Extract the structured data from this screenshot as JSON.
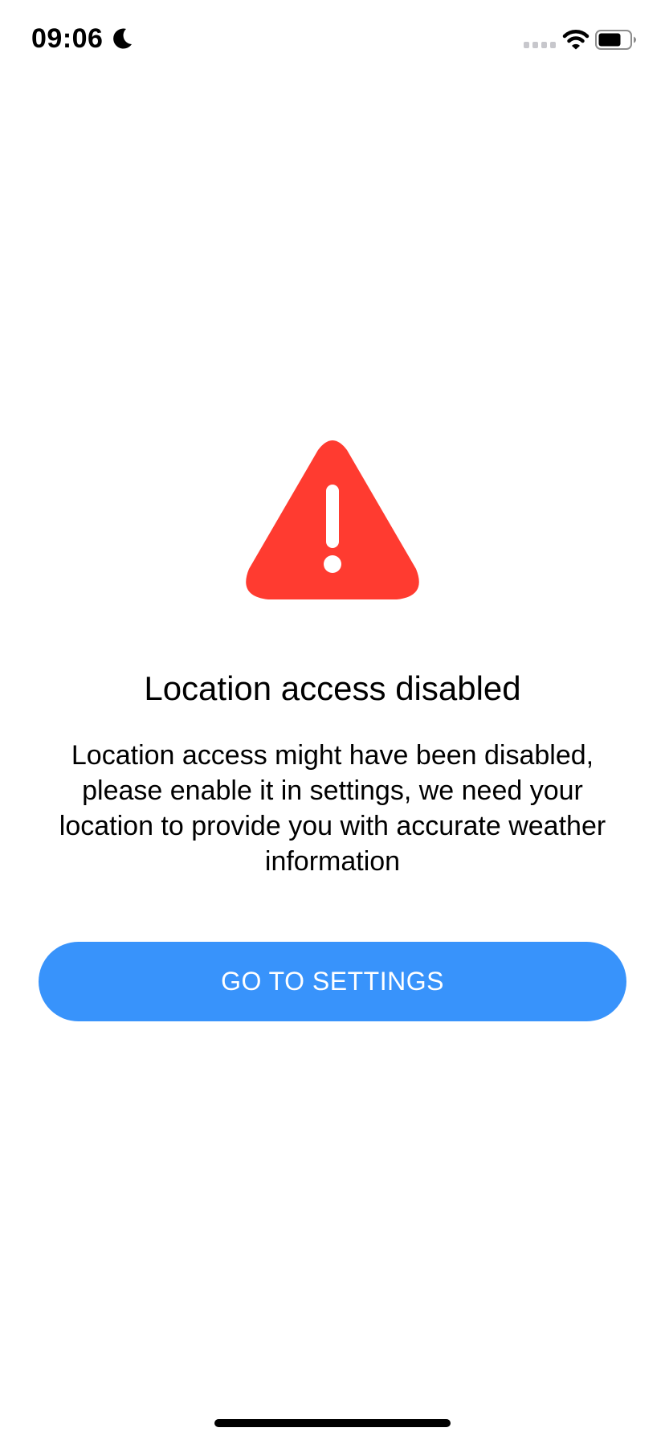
{
  "status_bar": {
    "time": "09:06",
    "icons": [
      "moon-icon",
      "signal-icon",
      "wifi-icon",
      "battery-icon"
    ]
  },
  "alert": {
    "icon": "warning-triangle-icon",
    "icon_color": "#ff3b30",
    "title": "Location access disabled",
    "message": "Location access might have been disabled, please enable it in settings, we need your location to provide you with accurate weather information"
  },
  "actions": {
    "settings_label": "GO TO SETTINGS",
    "button_color": "#3893fb"
  }
}
